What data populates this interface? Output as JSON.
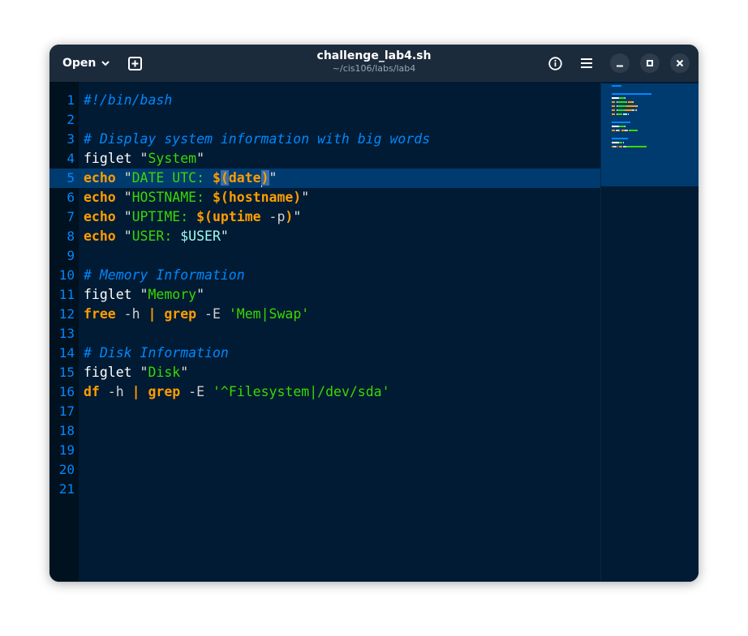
{
  "header": {
    "open_label": "Open",
    "title": "challenge_lab4.sh",
    "subtitle": "~/cis106/labs/lab4",
    "icons": [
      "chevron-down-icon",
      "new-tab-icon",
      "info-icon",
      "hamburger-menu-icon",
      "minimize-icon",
      "maximize-icon",
      "close-icon"
    ]
  },
  "editor": {
    "current_line": 5,
    "colors": {
      "background": "#001b33",
      "comment": "#0088ff",
      "keyword": "#ff9d00",
      "string": "#3ad900",
      "variable": "#9effef",
      "current_line": "#003b70"
    },
    "lines": [
      {
        "n": "1",
        "tokens": [
          {
            "c": "comment",
            "t": "#!/bin/bash"
          }
        ]
      },
      {
        "n": "2",
        "tokens": []
      },
      {
        "n": "3",
        "tokens": [
          {
            "c": "comment",
            "t": "# Display system information with big words"
          }
        ]
      },
      {
        "n": "4",
        "tokens": [
          {
            "c": "plain",
            "t": "figlet "
          },
          {
            "c": "quote",
            "t": "\""
          },
          {
            "c": "str",
            "t": "System"
          },
          {
            "c": "quote",
            "t": "\""
          }
        ]
      },
      {
        "n": "5",
        "tokens": [
          {
            "c": "kw",
            "t": "echo"
          },
          {
            "c": "plain",
            "t": " "
          },
          {
            "c": "quote",
            "t": "\""
          },
          {
            "c": "str",
            "t": "DATE UTC: "
          },
          {
            "c": "kw",
            "t": "$"
          },
          {
            "c": "match",
            "t": "("
          },
          {
            "c": "kw",
            "t": "date"
          },
          {
            "c": "cursor",
            "t": ""
          },
          {
            "c": "match",
            "t": ")"
          },
          {
            "c": "quote",
            "t": "\""
          }
        ]
      },
      {
        "n": "6",
        "tokens": [
          {
            "c": "kw",
            "t": "echo"
          },
          {
            "c": "plain",
            "t": " "
          },
          {
            "c": "quote",
            "t": "\""
          },
          {
            "c": "str",
            "t": "HOSTNAME: "
          },
          {
            "c": "kw",
            "t": "$(hostname)"
          },
          {
            "c": "quote",
            "t": "\""
          }
        ]
      },
      {
        "n": "7",
        "tokens": [
          {
            "c": "kw",
            "t": "echo"
          },
          {
            "c": "plain",
            "t": " "
          },
          {
            "c": "quote",
            "t": "\""
          },
          {
            "c": "str",
            "t": "UPTIME: "
          },
          {
            "c": "kw",
            "t": "$(uptime"
          },
          {
            "c": "opt",
            "t": " -p"
          },
          {
            "c": "kw",
            "t": ")"
          },
          {
            "c": "quote",
            "t": "\""
          }
        ]
      },
      {
        "n": "8",
        "tokens": [
          {
            "c": "kw",
            "t": "echo"
          },
          {
            "c": "plain",
            "t": " "
          },
          {
            "c": "quote",
            "t": "\""
          },
          {
            "c": "str",
            "t": "USER: "
          },
          {
            "c": "var",
            "t": "$USER"
          },
          {
            "c": "quote",
            "t": "\""
          }
        ]
      },
      {
        "n": "9",
        "tokens": []
      },
      {
        "n": "10",
        "tokens": [
          {
            "c": "comment",
            "t": "# Memory Information"
          }
        ]
      },
      {
        "n": "11",
        "tokens": [
          {
            "c": "plain",
            "t": "figlet "
          },
          {
            "c": "quote",
            "t": "\""
          },
          {
            "c": "str",
            "t": "Memory"
          },
          {
            "c": "quote",
            "t": "\""
          }
        ]
      },
      {
        "n": "12",
        "tokens": [
          {
            "c": "kw",
            "t": "free"
          },
          {
            "c": "opt",
            "t": " -h "
          },
          {
            "c": "kw",
            "t": "|"
          },
          {
            "c": "plain",
            "t": " "
          },
          {
            "c": "kw",
            "t": "grep"
          },
          {
            "c": "opt",
            "t": " -E "
          },
          {
            "c": "str",
            "t": "'Mem|Swap'"
          }
        ]
      },
      {
        "n": "13",
        "tokens": []
      },
      {
        "n": "14",
        "tokens": [
          {
            "c": "comment",
            "t": "# Disk Information"
          }
        ]
      },
      {
        "n": "15",
        "tokens": [
          {
            "c": "plain",
            "t": "figlet "
          },
          {
            "c": "quote",
            "t": "\""
          },
          {
            "c": "str",
            "t": "Disk"
          },
          {
            "c": "quote",
            "t": "\""
          }
        ]
      },
      {
        "n": "16",
        "tokens": [
          {
            "c": "kw",
            "t": "df"
          },
          {
            "c": "opt",
            "t": " -h "
          },
          {
            "c": "kw",
            "t": "|"
          },
          {
            "c": "plain",
            "t": " "
          },
          {
            "c": "kw",
            "t": "grep"
          },
          {
            "c": "opt",
            "t": " -E "
          },
          {
            "c": "str",
            "t": "'^Filesystem|/dev/sda'"
          }
        ]
      },
      {
        "n": "17",
        "tokens": []
      },
      {
        "n": "18",
        "tokens": []
      },
      {
        "n": "19",
        "tokens": []
      },
      {
        "n": "20",
        "tokens": []
      },
      {
        "n": "21",
        "tokens": []
      }
    ]
  }
}
